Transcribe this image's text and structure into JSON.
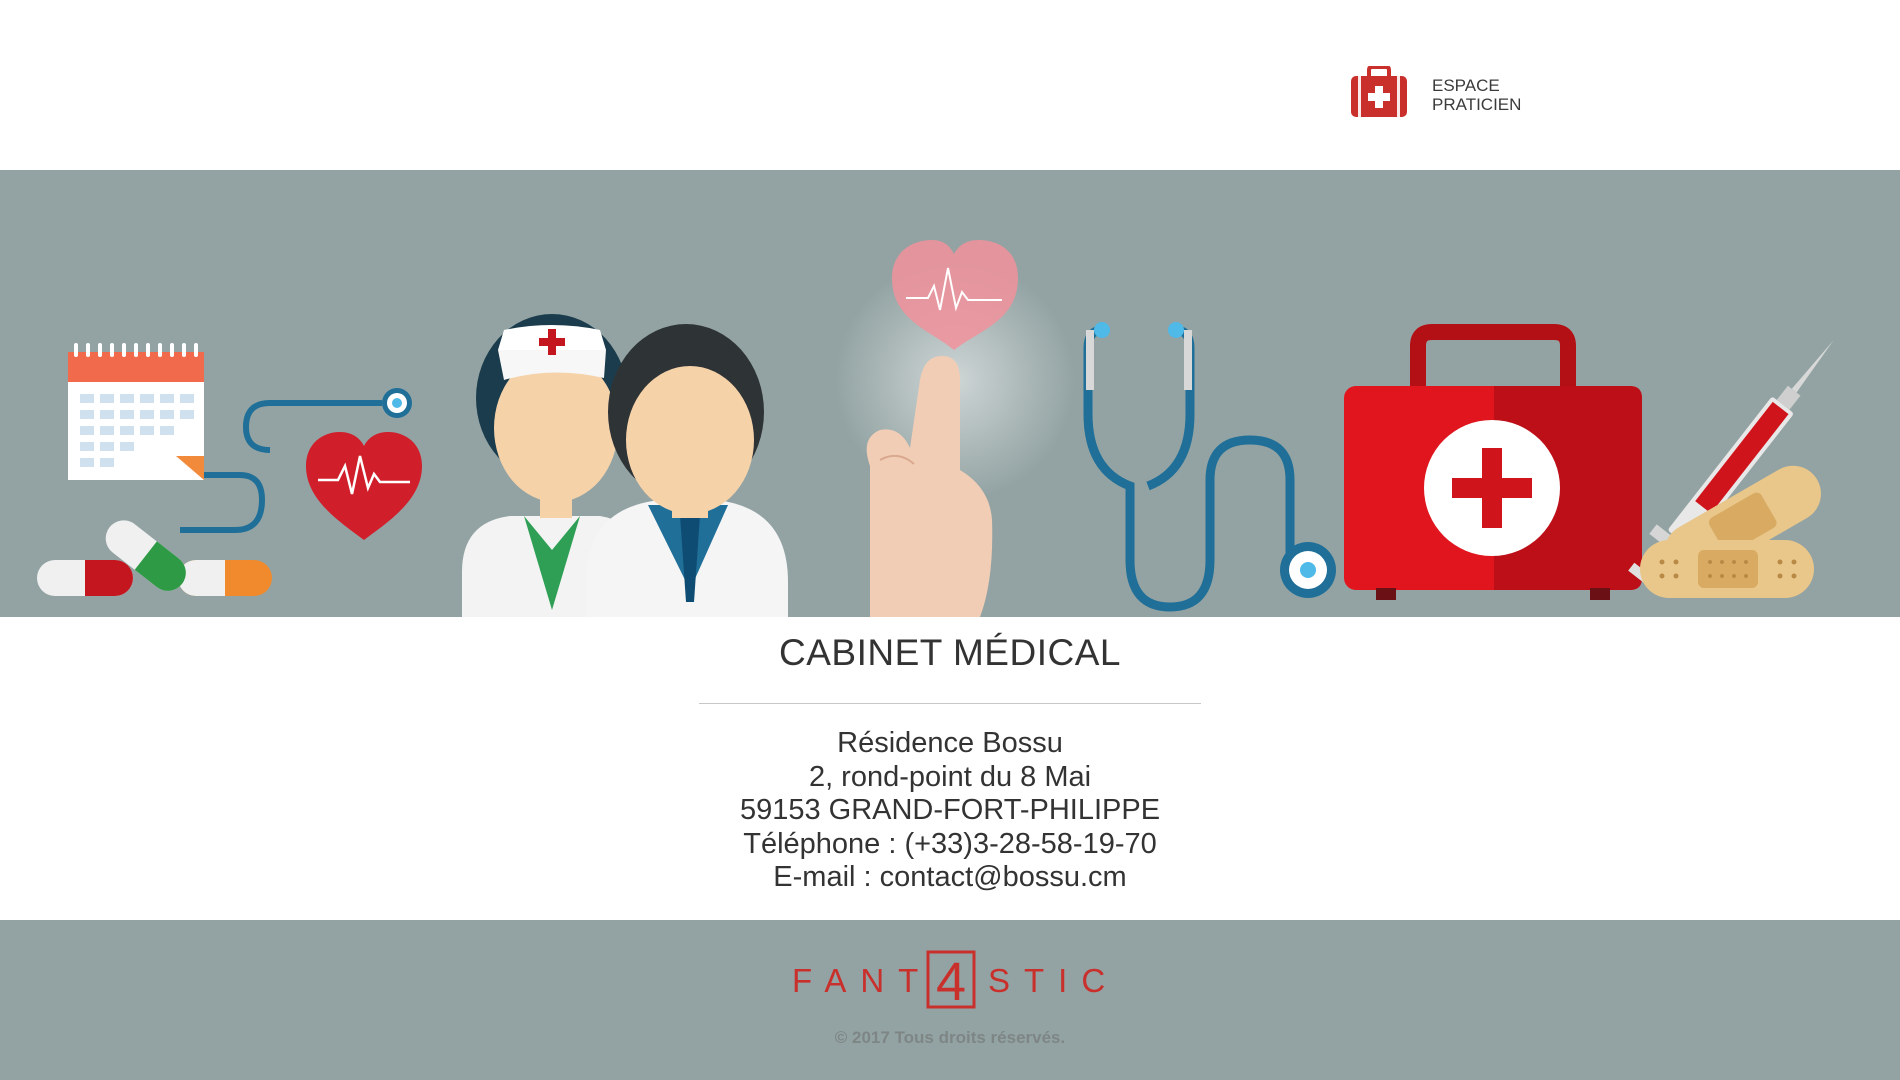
{
  "header": {
    "espace_praticien": {
      "line1": "ESPACE",
      "line2": "PRATICIEN",
      "icon": "first-aid-kit-icon"
    }
  },
  "banner": {
    "icons": [
      "calendar-icon",
      "heart-monitor-icon",
      "pills-icon",
      "nurse-icon",
      "doctor-icon",
      "heart-touch-icon",
      "stethoscope-icon",
      "first-aid-kit-icon",
      "syringe-icon",
      "bandage-icon"
    ]
  },
  "main": {
    "title": "CABINET MÉDICAL",
    "address_lines": [
      "Résidence Bossu",
      "2, rond-point du 8 Mai",
      "59153 GRAND-FORT-PHILIPPE",
      "Téléphone : (+33)3-28-58-19-70",
      "E-mail : contact@bossu.cm"
    ]
  },
  "footer": {
    "logo": {
      "left": "FANT",
      "digit": "4",
      "right": "STIC"
    },
    "copyright": "© 2017 Tous droits réservés."
  },
  "colors": {
    "accent_red": "#c9302c",
    "banner_bg": "#93a3a3",
    "text": "#333333"
  }
}
